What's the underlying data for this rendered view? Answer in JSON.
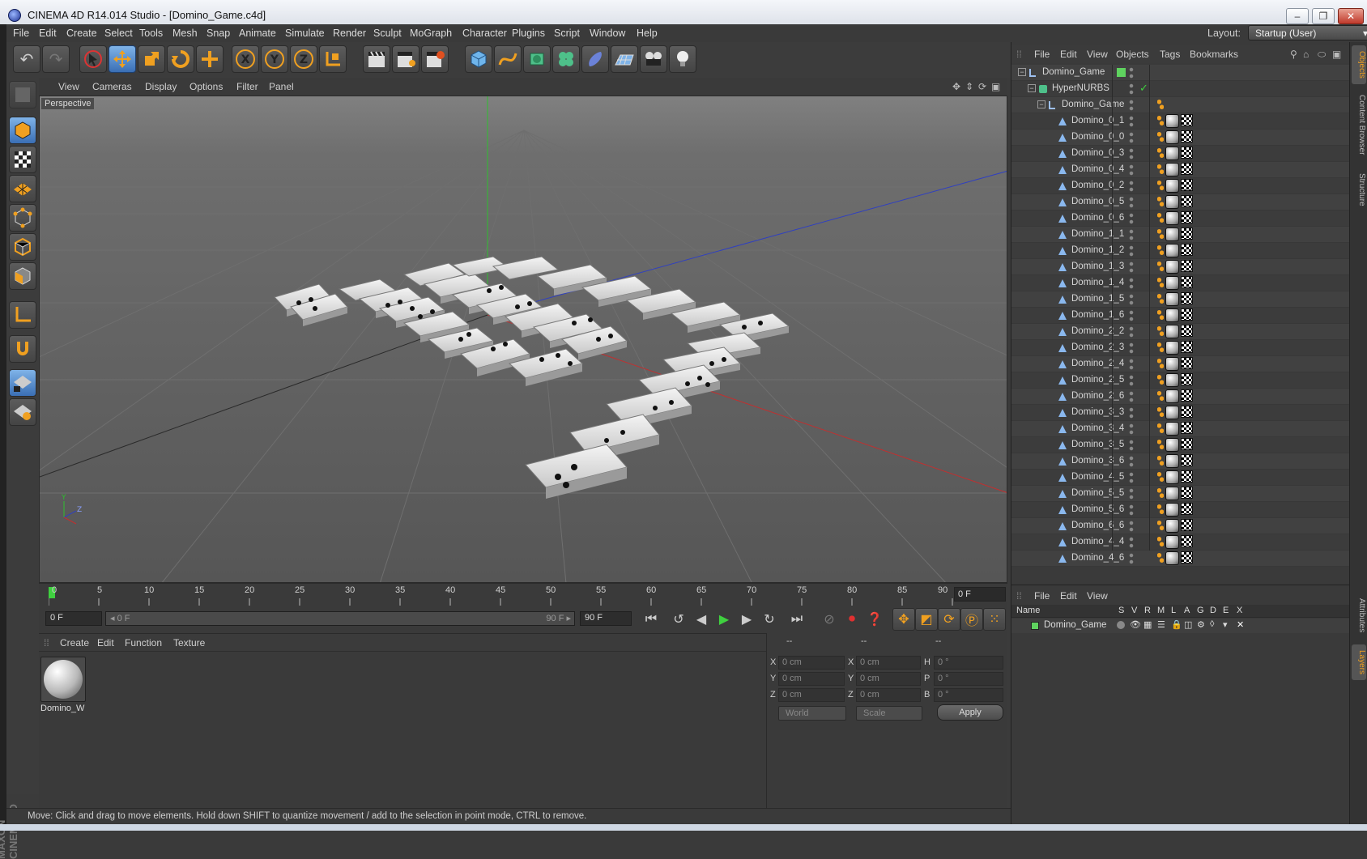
{
  "window": {
    "title": "CINEMA 4D R14.014 Studio - [Domino_Game.c4d]",
    "min": "–",
    "max": "❐",
    "close": "✕"
  },
  "menubar": {
    "items": [
      "File",
      "Edit",
      "Create",
      "Select",
      "Tools",
      "Mesh",
      "Snap",
      "Animate",
      "Simulate",
      "Render",
      "Sculpt",
      "MoGraph",
      "Character",
      "Plugins",
      "Script",
      "Window",
      "Help"
    ],
    "layout_label": "Layout:",
    "layout_value": "Startup (User)"
  },
  "viewport": {
    "menu": [
      "View",
      "Cameras",
      "Display",
      "Options",
      "Filter",
      "Panel"
    ],
    "camera_label": "Perspective",
    "axis_y": "Y",
    "axis_z": "Z"
  },
  "timeline": {
    "ticks": [
      "0",
      "5",
      "10",
      "15",
      "20",
      "25",
      "30",
      "35",
      "40",
      "45",
      "50",
      "55",
      "60",
      "65",
      "70",
      "75",
      "80",
      "85",
      "90"
    ],
    "current_frame": "0 F"
  },
  "playbar": {
    "start_field": "0 F",
    "range_start": "◂ 0 F",
    "range_end": "90 F ▸",
    "end_field": "90 F"
  },
  "material_manager": {
    "menu": [
      "Create",
      "Edit",
      "Function",
      "Texture"
    ],
    "materials": [
      {
        "name": "Domino_W"
      }
    ]
  },
  "attributes": {
    "col_headers": [
      "--",
      "--",
      "--"
    ],
    "rows": [
      {
        "l1": "X",
        "v1": "0 cm",
        "l2": "X",
        "v2": "0 cm",
        "l3": "H",
        "v3": "0 °"
      },
      {
        "l1": "Y",
        "v1": "0 cm",
        "l2": "Y",
        "v2": "0 cm",
        "l3": "P",
        "v3": "0 °"
      },
      {
        "l1": "Z",
        "v1": "0 cm",
        "l2": "Z",
        "v2": "0 cm",
        "l3": "B",
        "v3": "0 °"
      }
    ],
    "space": "World",
    "mode": "Scale",
    "apply": "Apply"
  },
  "status": "Move: Click and drag to move elements. Hold down SHIFT to quantize movement / add to the selection in point mode, CTRL to remove.",
  "object_manager": {
    "menu": [
      "File",
      "Edit",
      "View",
      "Objects",
      "Tags",
      "Bookmarks"
    ],
    "objects": [
      {
        "name": "Domino_Game",
        "level": 0,
        "type": "null"
      },
      {
        "name": "HyperNURBS",
        "level": 1,
        "type": "nurbs"
      },
      {
        "name": "Domino_Game",
        "level": 2,
        "type": "null"
      },
      {
        "name": "Domino_0_1",
        "level": 3,
        "type": "mesh"
      },
      {
        "name": "Domino_0_0",
        "level": 3,
        "type": "mesh"
      },
      {
        "name": "Domino_0_3",
        "level": 3,
        "type": "mesh"
      },
      {
        "name": "Domino_0_4",
        "level": 3,
        "type": "mesh"
      },
      {
        "name": "Domino_0_2",
        "level": 3,
        "type": "mesh"
      },
      {
        "name": "Domino_0_5",
        "level": 3,
        "type": "mesh"
      },
      {
        "name": "Domino_0_6",
        "level": 3,
        "type": "mesh"
      },
      {
        "name": "Domino_1_1",
        "level": 3,
        "type": "mesh"
      },
      {
        "name": "Domino_1_2",
        "level": 3,
        "type": "mesh"
      },
      {
        "name": "Domino_1_3",
        "level": 3,
        "type": "mesh"
      },
      {
        "name": "Domino_1_4",
        "level": 3,
        "type": "mesh"
      },
      {
        "name": "Domino_1_5",
        "level": 3,
        "type": "mesh"
      },
      {
        "name": "Domino_1_6",
        "level": 3,
        "type": "mesh"
      },
      {
        "name": "Domino_2_2",
        "level": 3,
        "type": "mesh"
      },
      {
        "name": "Domino_2_3",
        "level": 3,
        "type": "mesh"
      },
      {
        "name": "Domino_2_4",
        "level": 3,
        "type": "mesh"
      },
      {
        "name": "Domino_2_5",
        "level": 3,
        "type": "mesh"
      },
      {
        "name": "Domino_2_6",
        "level": 3,
        "type": "mesh"
      },
      {
        "name": "Domino_3_3",
        "level": 3,
        "type": "mesh"
      },
      {
        "name": "Domino_3_4",
        "level": 3,
        "type": "mesh"
      },
      {
        "name": "Domino_3_5",
        "level": 3,
        "type": "mesh"
      },
      {
        "name": "Domino_3_6",
        "level": 3,
        "type": "mesh"
      },
      {
        "name": "Domino_4_5",
        "level": 3,
        "type": "mesh"
      },
      {
        "name": "Domino_5_5",
        "level": 3,
        "type": "mesh"
      },
      {
        "name": "Domino_5_6",
        "level": 3,
        "type": "mesh"
      },
      {
        "name": "Domino_6_6",
        "level": 3,
        "type": "mesh"
      },
      {
        "name": "Domino_4_4",
        "level": 3,
        "type": "mesh"
      },
      {
        "name": "Domino_4_6",
        "level": 3,
        "type": "mesh"
      }
    ]
  },
  "layer_manager": {
    "menu": [
      "File",
      "Edit",
      "View"
    ],
    "columns": [
      "Name",
      "S",
      "V",
      "R",
      "M",
      "L",
      "A",
      "G",
      "D",
      "E",
      "X"
    ],
    "layers": [
      {
        "name": "Domino_Game",
        "color": "#5fd35f"
      }
    ]
  },
  "right_tabs": [
    "Objects",
    "Content Browser",
    "Structure",
    "Attributes",
    "Layers"
  ],
  "colors": {
    "accent": "#f0a020",
    "selected_tool": "#3a6fb5",
    "y_axis": "#2fbf2f",
    "x_axis": "#c03030",
    "z_axis": "#3040c0"
  }
}
